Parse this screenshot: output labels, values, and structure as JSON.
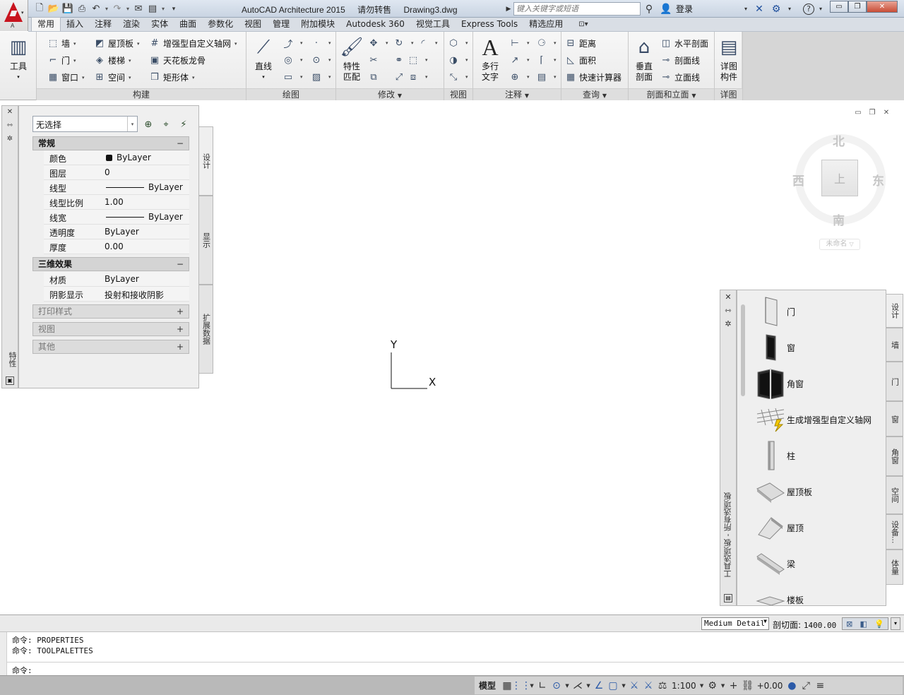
{
  "window": {
    "app_logo_letter": "A",
    "title_app": "AutoCAD Architecture 2015",
    "title_note": "请勿转售",
    "title_doc": "Drawing3.dwg",
    "search_placeholder": "键入关键字或短语",
    "login_label": "登录",
    "controls": {
      "minimize": "▭",
      "restore": "❐",
      "close": "✕"
    }
  },
  "quick_access": {
    "icons": [
      "new-icon",
      "open-icon",
      "save-icon",
      "print-icon",
      "undo-icon",
      "redo-icon",
      "share-icon",
      "workspace-icon"
    ]
  },
  "tabs": [
    {
      "label": "常用",
      "active": true
    },
    {
      "label": "插入"
    },
    {
      "label": "注释"
    },
    {
      "label": "渲染"
    },
    {
      "label": "实体"
    },
    {
      "label": "曲面"
    },
    {
      "label": "参数化"
    },
    {
      "label": "视图"
    },
    {
      "label": "管理"
    },
    {
      "label": "附加模块"
    },
    {
      "label": "Autodesk 360"
    },
    {
      "label": "视觉工具"
    },
    {
      "label": "Express Tools"
    },
    {
      "label": "精选应用"
    }
  ],
  "ribbon": {
    "tools_label": "工具",
    "build": {
      "title": "构建",
      "items": [
        "墙",
        "门",
        "窗口",
        "屋顶板",
        "楼梯",
        "空间",
        "增强型自定义轴网",
        "天花板龙骨",
        "矩形体"
      ]
    },
    "draw": {
      "title": "绘图",
      "line_label": "直线"
    },
    "modify": {
      "title": "修改",
      "match_label_1": "特性",
      "match_label_2": "匹配"
    },
    "view": {
      "title": "视图"
    },
    "annotate": {
      "title": "注释",
      "mtext_label_1": "多行",
      "mtext_label_2": "文字"
    },
    "query": {
      "title": "查询",
      "items": [
        "距离",
        "面积",
        "快速计算器"
      ]
    },
    "section": {
      "title": "剖面和立面",
      "vsec_1": "垂直",
      "vsec_2": "剖面",
      "items": [
        "水平剖面",
        "剖面线",
        "立面线"
      ]
    },
    "detail": {
      "title": "详图",
      "btn_1": "详图",
      "btn_2": "构件"
    }
  },
  "properties_palette": {
    "vertical_title": "特性",
    "selection": "无选择",
    "sections": {
      "general": {
        "title": "常规",
        "toggle": "−"
      },
      "three_d": {
        "title": "三维效果",
        "toggle": "−"
      },
      "plot_style": {
        "title": "打印样式",
        "toggle": "+"
      },
      "view": {
        "title": "视图",
        "toggle": "+"
      },
      "misc": {
        "title": "其他",
        "toggle": "+"
      }
    },
    "general_rows": [
      {
        "key": "颜色",
        "value": "ByLayer"
      },
      {
        "key": "图层",
        "value": "0"
      },
      {
        "key": "线型",
        "value": "ByLayer"
      },
      {
        "key": "线型比例",
        "value": "1.00"
      },
      {
        "key": "线宽",
        "value": "ByLayer"
      },
      {
        "key": "透明度",
        "value": "ByLayer"
      },
      {
        "key": "厚度",
        "value": "0.00"
      }
    ],
    "three_d_rows": [
      {
        "key": "材质",
        "value": "ByLayer"
      },
      {
        "key": "阴影显示",
        "value": "投射和接收阴影"
      }
    ],
    "tabs": [
      "设计",
      "显示",
      "扩展数据"
    ]
  },
  "ucs": {
    "x": "X",
    "y": "Y"
  },
  "viewcube": {
    "north": "北",
    "south": "南",
    "east": "东",
    "west": "西",
    "top_face": "上",
    "wcs": "未命名"
  },
  "tool_palette": {
    "vertical_title": "工具选项板 - 所有选项板",
    "items": [
      "门",
      "窗",
      "角窗",
      "生成增强型自定义轴网",
      "柱",
      "屋顶板",
      "屋顶",
      "梁",
      "楼板"
    ],
    "tabs": [
      "设计",
      "墙",
      "门",
      "窗",
      "角窗",
      "空间",
      "设备...",
      "体量"
    ]
  },
  "viewport_status": {
    "detail_level": "Medium Detail",
    "cut_plane_label": "剖切面:",
    "cut_plane_value": "1400.00"
  },
  "command_line": {
    "history": [
      "命令: PROPERTIES",
      "命令: TOOLPALETTES"
    ],
    "prompt": "命令:"
  },
  "statusbar": {
    "model_label": "模型",
    "scale_label": "1:100",
    "offset_label": "+0.00"
  }
}
